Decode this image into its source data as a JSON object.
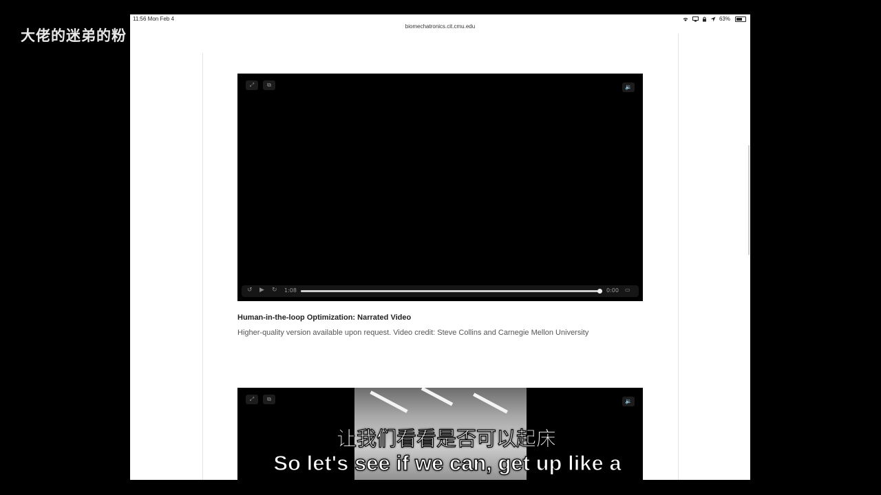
{
  "overlay": {
    "watermark": "大佬的迷弟的粉",
    "subtitle_cn": "让我们看看是否可以起床",
    "subtitle_en": "So let's see if we can, get up like a"
  },
  "status_bar": {
    "time": "11:56",
    "date": "Mon Feb 4",
    "battery_text": "63%",
    "battery_level": 0.63,
    "icons": [
      "wifi-icon",
      "screen-mirror-icon",
      "lock-rotation-icon",
      "location-icon",
      "battery-icon"
    ]
  },
  "browser": {
    "url": "biomechatronics.cit.cmu.edu"
  },
  "video1": {
    "current_time": "1:08",
    "remaining_time": "0:00",
    "progress": 0.99,
    "icons": [
      "fullscreen-icon",
      "picture-in-picture-icon",
      "volume-icon",
      "skip-back-icon",
      "play-icon",
      "skip-forward-icon",
      "airplay-icon"
    ]
  },
  "caption": {
    "title": "Human-in-the-loop Optimization: Narrated Video",
    "credit": "Higher-quality version available upon request. Video credit: Steve Collins and Carnegie Mellon University"
  },
  "video2": {
    "icons": [
      "fullscreen-icon",
      "picture-in-picture-icon",
      "volume-icon"
    ]
  }
}
